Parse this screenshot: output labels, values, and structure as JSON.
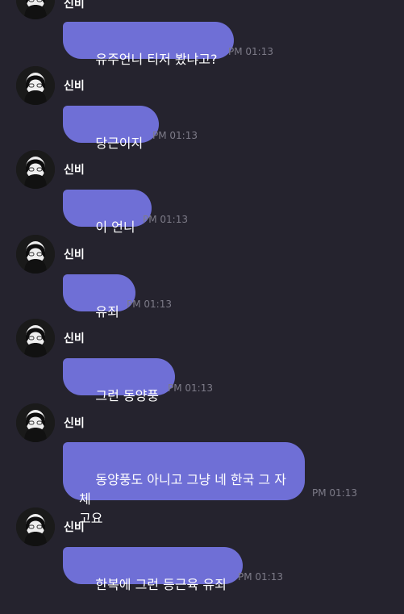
{
  "sender_name": "신비",
  "messages": [
    {
      "text": "유주언니 티저 봤냐고?",
      "time": "PM 01:13"
    },
    {
      "text": "당근이지",
      "time": "PM 01:13"
    },
    {
      "text": "이 언니",
      "time": "PM 01:13"
    },
    {
      "text": "유죄",
      "time": "PM 01:13"
    },
    {
      "text": "그런 동양풍",
      "time": "PM 01:13"
    },
    {
      "text": "동양풍도 아니고 그냥 네 한국 그 자체\n고요",
      "time": "PM 01:13"
    },
    {
      "text": "한복에 그런 등근육 유죄",
      "time": "PM 01:13"
    }
  ],
  "colors": {
    "background": "#25232e",
    "bubble": "#6f6fd6",
    "timestamp": "#7d7b88"
  },
  "icons": {
    "avatar": "profile-photo-icon"
  }
}
